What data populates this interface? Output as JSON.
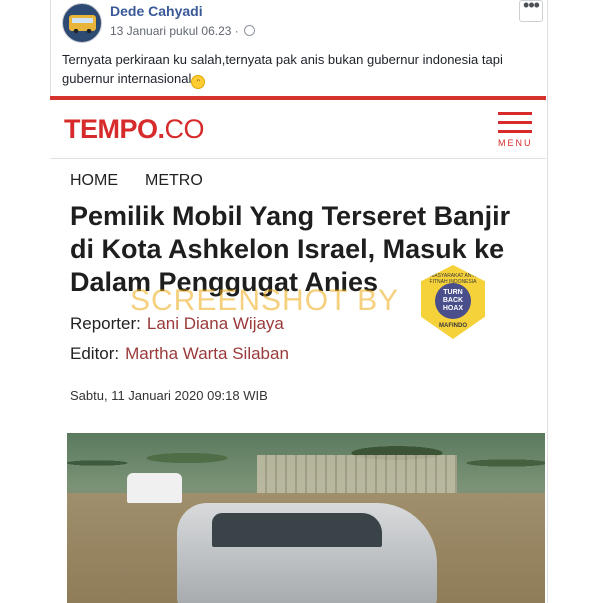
{
  "post": {
    "author": "Dede Cahyadi",
    "timestamp": "13 Januari pukul 06.23 ·",
    "more_label": "•••",
    "text": "Ternyata perkiraan ku salah,ternyata pak anis bukan gubernur indonesia tapi gubernur internasional",
    "emoji": "😁"
  },
  "article": {
    "logo_main": "TEMPO",
    "logo_dot": ".",
    "logo_suffix": "CO",
    "menu_label": "MENU",
    "nav": [
      "HOME",
      "METRO"
    ],
    "headline": "Pemilik Mobil Yang Terseret Banjir di Kota Ashkelon Israel, Masuk ke Dalam Penggugat Anies",
    "reporter_label": "Reporter:",
    "reporter": "Lani Diana Wijaya",
    "editor_label": "Editor:",
    "editor": "Martha Warta Silaban",
    "date": "Sabtu, 11 Januari 2020 09:18 WIB"
  },
  "watermark": "SCREENSHOT BY",
  "badge": {
    "ring_text": "MASYARAKAT ANTI FITNAH INDONESIA",
    "center": "TURN BACK HOAX",
    "foot": "MAFINDO"
  },
  "colors": {
    "brand_red": "#d72b2b",
    "fb_blue": "#385898"
  }
}
